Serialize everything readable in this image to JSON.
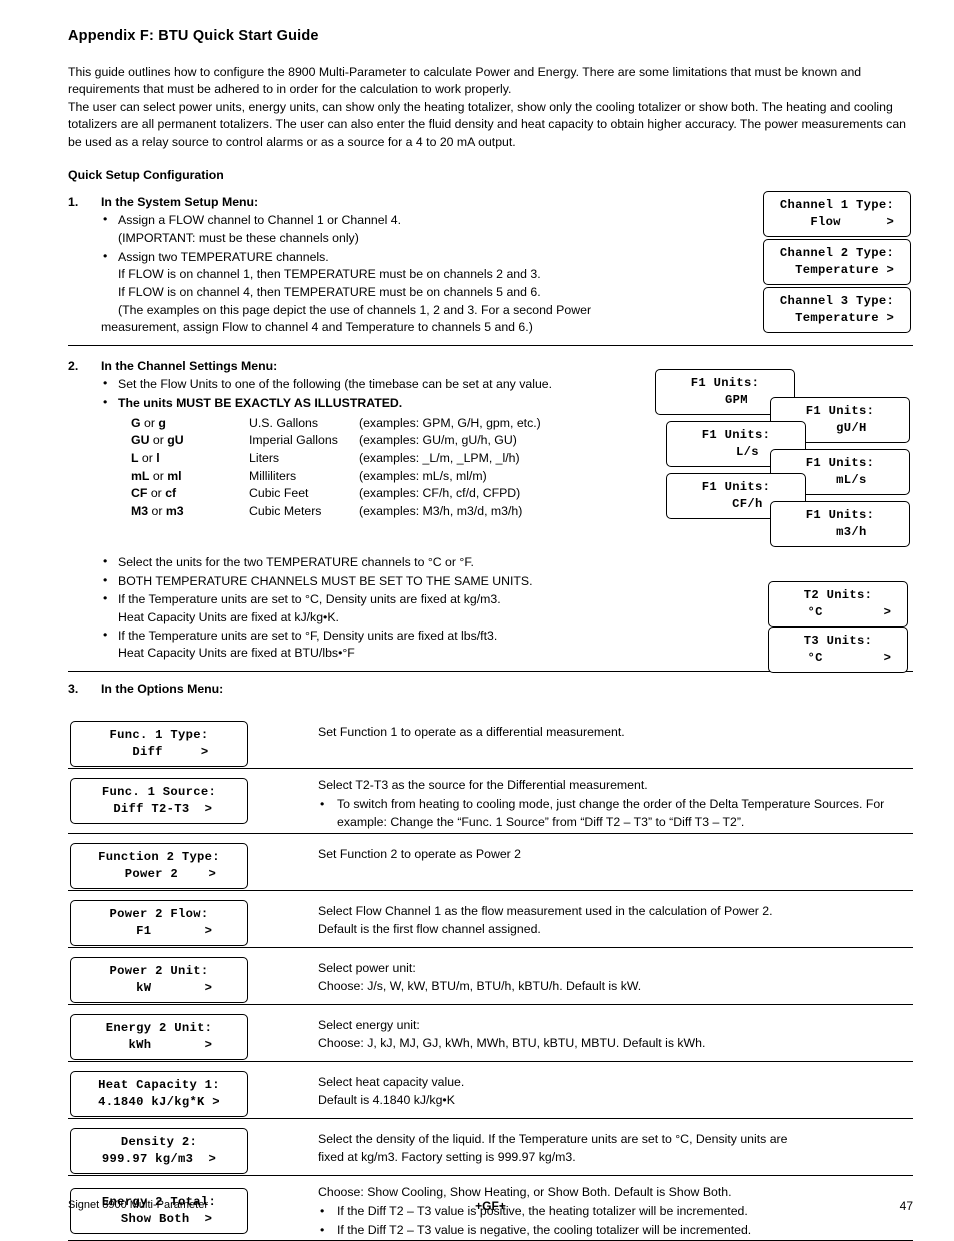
{
  "title": "Appendix F:  BTU Quick Start Guide",
  "intro": [
    "This guide outlines how to configure the 8900 Multi-Parameter to calculate Power and Energy.  There are some limitations that must be known and requirements that must be adhered to in order for the calculation to work properly.",
    "The user can select power units, energy units, can show only the heating totalizer, show only the cooling totalizer or show both.  The heating and cooling totalizers are all permanent totalizers.  The user can also enter the fluid density and heat capacity to obtain higher accuracy.  The power measurements can be used as a relay source to control alarms or as a source for a 4 to 20 mA output."
  ],
  "quick_setup_heading": "Quick Setup Configuration",
  "step1": {
    "num": "1.",
    "title": "In the System Setup Menu:",
    "bullets": [
      "Assign a FLOW channel to Channel 1 or Channel 4.",
      "Assign two TEMPERATURE channels."
    ],
    "line_important": "(IMPORTANT:  must be these channels only)",
    "line_flow1": "If FLOW is on channel 1, then TEMPERATURE must be on channels 2 and 3.",
    "line_flow4": "If FLOW is on channel 4, then TEMPERATURE must be on channels 5 and 6.",
    "line_examples1": "(The examples on this page depict the use of channels 1, 2 and 3.  For a second Power",
    "line_examples2": "measurement, assign Flow to channel 4 and Temperature to channels 5 and 6.)",
    "lcds": [
      {
        "l1": "Channel 1 Type:",
        "l2": "    Flow      >"
      },
      {
        "l1": "Channel 2 Type:",
        "l2": "  Temperature >"
      },
      {
        "l1": "Channel 3 Type:",
        "l2": "  Temperature >"
      }
    ]
  },
  "step2": {
    "num": "2.",
    "title": "In the Channel Settings Menu:",
    "bullets": [
      "Set the Flow Units to one of the following (the timebase can be set at any value.",
      "The units MUST BE EXACTLY AS ILLUSTRATED."
    ],
    "units_rows": [
      {
        "abbr_bold1": "G",
        "or": " or ",
        "abbr_bold2": "g",
        "name": "U.S. Gallons",
        "examples": "(examples:  GPM, G/H, gpm, etc.)"
      },
      {
        "abbr_bold1": "GU",
        "or": " or ",
        "abbr_bold2": "gU",
        "name": "Imperial Gallons",
        "examples": "(examples:  GU/m, gU/h, GU)"
      },
      {
        "abbr_bold1": "L",
        "or": " or ",
        "abbr_bold2": "l",
        "name": "Liters",
        "examples": "(examples:  _L/m, _LPM,  _l/h)"
      },
      {
        "abbr_bold1": "mL",
        "or": " or ",
        "abbr_bold2": "ml",
        "name": "Milliliters",
        "examples": "(examples:  mL/s, ml/m)"
      },
      {
        "abbr_bold1": "CF",
        "or": " or ",
        "abbr_bold2": "cf",
        "name": "Cubic Feet",
        "examples": "(examples:  CF/h, cf/d, CFPD)"
      },
      {
        "abbr_bold1": "M3",
        "or": " or ",
        "abbr_bold2": "m3",
        "name": "Cubic Meters",
        "examples": "(examples:  M3/h, m3/d, m3/h)"
      }
    ],
    "flow_lcds": [
      {
        "l1": "F1 Units:",
        "l2": "   GPM"
      },
      {
        "l1": "F1 Units:",
        "l2": "   gU/H"
      },
      {
        "l1": "F1 Units:",
        "l2": "   L/s"
      },
      {
        "l1": "F1 Units:",
        "l2": "   mL/s"
      },
      {
        "l1": "F1 Units:",
        "l2": "   CF/h"
      },
      {
        "l1": "F1 Units:",
        "l2": "   m3/h"
      }
    ],
    "temp_bullets": [
      "Select the units for the two TEMPERATURE channels to °C or °F.",
      "BOTH TEMPERATURE CHANNELS MUST BE SET TO THE SAME UNITS.",
      "If the Temperature units are set to °C, Density units are fixed at kg/m3.",
      "If the Temperature units are set to °F, Density units are fixed at lbs/ft3."
    ],
    "temp_sub1": "Heat Capacity Units are fixed at kJ/kg•K.",
    "temp_sub2": "Heat Capacity Units are fixed at BTU/lbs•°F",
    "temp_lcds": [
      {
        "l1": "T2 Units:",
        "l2": "   °C        >"
      },
      {
        "l1": "T3 Units:",
        "l2": "   °C        >"
      }
    ]
  },
  "step3": {
    "num": "3.",
    "title": "In the Options Menu:",
    "rows": [
      {
        "lcd": {
          "l1": "Func. 1 Type:",
          "l2": "   Diff     >"
        },
        "desc": [
          "Set Function 1 to operate as a differential measurement."
        ],
        "bullets": []
      },
      {
        "lcd": {
          "l1": "Func. 1 Source:",
          "l2": " Diff T2-T3  >"
        },
        "desc": [
          "Select T2-T3 as the source for the Differential measurement."
        ],
        "bullets": [
          "To switch from heating to cooling mode, just change the order of the Delta Temperature Sources.  For example:  Change the “Func. 1 Source” from “Diff T2 – T3” to “Diff T3 – T2”."
        ]
      },
      {
        "lcd": {
          "l1": "Function 2 Type:",
          "l2": "   Power 2    >"
        },
        "desc": [
          "Set Function 2 to operate as Power 2"
        ],
        "bullets": []
      },
      {
        "lcd": {
          "l1": "Power 2 Flow:",
          "l2": "    F1       >"
        },
        "desc": [
          "Select Flow Channel 1 as the flow measurement used in the calculation of Power 2.",
          "Default is the first flow channel assigned."
        ],
        "bullets": []
      },
      {
        "lcd": {
          "l1": "Power 2 Unit:",
          "l2": "    kW       >"
        },
        "desc": [
          "Select power unit:",
          "Choose: J/s, W, kW, BTU/m, BTU/h, kBTU/h.  Default is kW."
        ],
        "bullets": []
      },
      {
        "lcd": {
          "l1": "Energy 2 Unit:",
          "l2": "   kWh       >"
        },
        "desc": [
          "Select energy unit:",
          "Choose: J, kJ, MJ, GJ, kWh, MWh, BTU, kBTU, MBTU.  Default is kWh."
        ],
        "bullets": []
      },
      {
        "lcd": {
          "l1": "Heat Capacity 1:",
          "l2": "4.1840 kJ/kg*K >"
        },
        "desc": [
          "Select heat capacity value.",
          "Default is 4.1840 kJ/kg•K"
        ],
        "bullets": []
      },
      {
        "lcd": {
          "l1": "Density 2:",
          "l2": "999.97 kg/m3  >"
        },
        "desc": [
          "Select the density of the liquid. If the Temperature units are set to °C, Density units are",
          "fixed at kg/m3.  Factory setting is 999.97 kg/m3."
        ],
        "bullets": []
      },
      {
        "lcd": {
          "l1": "Energy 2 Total:",
          "l2": "  Show Both  >"
        },
        "desc": [
          "Choose:  Show Cooling, Show Heating, or Show Both.  Default is Show Both."
        ],
        "bullets": [
          "If the Diff T2 – T3 value is positive, the heating totalizer will be incremented.",
          "If the Diff T2 – T3 value is negative, the cooling totalizer will be incremented."
        ]
      }
    ]
  },
  "footer": {
    "left": "Signet 8900 Multi-Parameter",
    "center": "+GF+",
    "right": "47"
  }
}
